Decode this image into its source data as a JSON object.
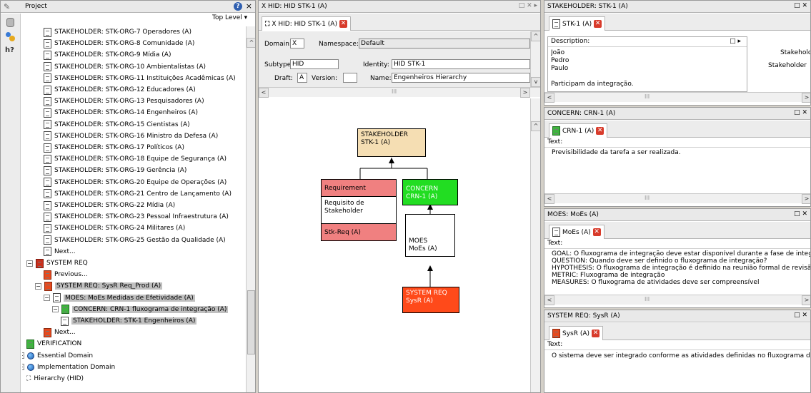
{
  "project_panel": {
    "title": "Project",
    "top_level": "Top Level ▾",
    "tree": [
      {
        "label": "STAKEHOLDER: STK-ORG-7  Operadores (A)",
        "icon": "doc",
        "indent": 3
      },
      {
        "label": "STAKEHOLDER: STK-ORG-8  Comunidade (A)",
        "icon": "doc",
        "indent": 3
      },
      {
        "label": "STAKEHOLDER: STK-ORG-9  Mídia (A)",
        "icon": "doc",
        "indent": 3
      },
      {
        "label": "STAKEHOLDER: STK-ORG-10  Ambientalistas (A)",
        "icon": "doc",
        "indent": 3
      },
      {
        "label": "STAKEHOLDER: STK-ORG-11  Instituições Acadêmicas (A)",
        "icon": "doc",
        "indent": 3
      },
      {
        "label": "STAKEHOLDER: STK-ORG-12  Educadores (A)",
        "icon": "doc",
        "indent": 3
      },
      {
        "label": "STAKEHOLDER: STK-ORG-13  Pesquisadores (A)",
        "icon": "doc",
        "indent": 3
      },
      {
        "label": "STAKEHOLDER: STK-ORG-14  Engenheiros (A)",
        "icon": "doc",
        "indent": 3
      },
      {
        "label": "STAKEHOLDER: STK-ORG-15  Cientistas (A)",
        "icon": "doc",
        "indent": 3
      },
      {
        "label": "STAKEHOLDER: STK-ORG-16  Ministro da Defesa (A)",
        "icon": "doc",
        "indent": 3
      },
      {
        "label": "STAKEHOLDER: STK-ORG-17  Políticos (A)",
        "icon": "doc",
        "indent": 3
      },
      {
        "label": "STAKEHOLDER: STK-ORG-18  Equipe de Segurança (A)",
        "icon": "doc",
        "indent": 3
      },
      {
        "label": "STAKEHOLDER: STK-ORG-19  Gerência (A)",
        "icon": "doc",
        "indent": 3
      },
      {
        "label": "STAKEHOLDER: STK-ORG-20  Equipe de Operações (A)",
        "icon": "doc",
        "indent": 3
      },
      {
        "label": "STAKEHOLDER: STK-ORG-21  Centro de Lançamento (A)",
        "icon": "doc",
        "indent": 3
      },
      {
        "label": "STAKEHOLDER: STK-ORG-22  Mídia (A)",
        "icon": "doc",
        "indent": 3
      },
      {
        "label": "STAKEHOLDER: STK-ORG-23  Pessoal Infraestrutura (A)",
        "icon": "doc",
        "indent": 3
      },
      {
        "label": "STAKEHOLDER: STK-ORG-24  Militares (A)",
        "icon": "doc",
        "indent": 3
      },
      {
        "label": "STAKEHOLDER: STK-ORG-25  Gestão da Qualidade (A)",
        "icon": "doc",
        "indent": 3
      },
      {
        "label": "Next...",
        "icon": "doc",
        "indent": 3
      },
      {
        "label": "SYSTEM REQ",
        "icon": "doc-red",
        "indent": 1,
        "expander": "−"
      },
      {
        "label": "Previous...",
        "icon": "doc-orange",
        "indent": 3
      },
      {
        "label": "SYSTEM REQ: SysR  Req_Prod (A)",
        "icon": "doc-orange",
        "indent": 2,
        "expander": "−",
        "selected": true
      },
      {
        "label": "MOES: MoEs  Medidas de Efetividade (A)",
        "icon": "doc",
        "indent": 3,
        "expander": "−",
        "selected": true
      },
      {
        "label": "CONCERN: CRN-1  fluxograma de integração (A)",
        "icon": "doc-green",
        "indent": 4,
        "expander": "−",
        "selected": true
      },
      {
        "label": "STAKEHOLDER: STK-1  Engenheiros (A)",
        "icon": "doc",
        "indent": 5,
        "selected": true
      },
      {
        "label": "Next...",
        "icon": "doc-orange",
        "indent": 3
      },
      {
        "label": "VERIFICATION",
        "icon": "doc-green",
        "indent": 1
      },
      {
        "label": "Essential Domain",
        "icon": "globe",
        "indent": 0,
        "expander": "+"
      },
      {
        "label": "Implementation Domain",
        "icon": "globe",
        "indent": 0,
        "expander": "+"
      },
      {
        "label": "Hierarchy (HID)",
        "icon": "hid",
        "indent": 1
      }
    ]
  },
  "hid_panel": {
    "title": "X HID: HID STK-1 (A)",
    "tab_label": "X HID: HID STK-1 (A)",
    "domain_label": "Domain:",
    "domain_value": "X",
    "namespace_label": "Namespace:",
    "namespace_value": "Default",
    "subtype_label": "Subtype:",
    "subtype_value": "HID",
    "identity_label": "Identity:",
    "identity_value": "HID STK-1",
    "draft_label": "Draft:",
    "draft_value": "A",
    "version_label": "Version:",
    "version_value": "",
    "name_label": "Name:",
    "name_value": "Engenheiros Hierarchy",
    "scroll_mark": "III",
    "diagram": {
      "stakeholder": {
        "line1": "STAKEHOLDER",
        "line2": "STK-1 (A)"
      },
      "requirement": {
        "header": "Requirement",
        "body1": "Requisito de",
        "body2": "Stakeholder",
        "footer": "Stk-Req (A)"
      },
      "concern": {
        "line1": "CONCERN",
        "line2": "CRN-1 (A)"
      },
      "moes": {
        "line1": "MOES",
        "line2": "MoEs (A)"
      },
      "sysreq": {
        "line1": "SYSTEM REQ",
        "line2": "SysR (A)"
      }
    }
  },
  "right_panels": {
    "stakeholder": {
      "title": "STAKEHOLDER: STK-1 (A)",
      "tab": "STK-1 (A)",
      "desc_label": "Description:",
      "desc_text": "João\nPedro\nPaulo\n\nParticipam da integração.",
      "side1": "Stakeholde",
      "side2": "Stakeholder"
    },
    "concern": {
      "title": "CONCERN: CRN-1 (A)",
      "tab": "CRN-1 (A)",
      "text_label": "Text:",
      "text": "Previsibilidade da tarefa a ser realizada."
    },
    "moes": {
      "title": "MOES: MoEs (A)",
      "tab": "MoEs (A)",
      "text_label": "Text:",
      "text": "GOAL: O fluxograma de integração deve estar disponível durante a fase de integra\nQUESTION: Quando deve ser definido o fluxograma de integração?\nHYPOTHESIS: O fluxograma de integração é definido na reunião formal de revisão d\nMETRIC: Fluxograma de integração\nMEASURES: O fluxograma de atividades deve ser compreensível"
    },
    "sysreq": {
      "title": "SYSTEM REQ: SysR (A)",
      "tab": "SysR (A)",
      "text_label": "Text:",
      "text": "O sistema deve ser integrado conforme as atividades definidas no fluxograma de in"
    },
    "scroll_mark": "III"
  },
  "colors": {
    "stakeholder_node": "#f5deb3",
    "requirement_node": "#f08080",
    "concern_node": "#22dd22",
    "sysreq_node": "#ff4a1a"
  }
}
